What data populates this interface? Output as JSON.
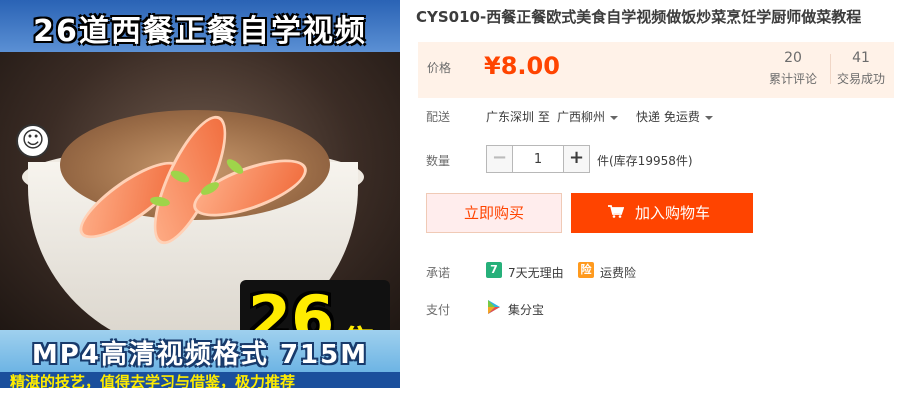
{
  "product_image": {
    "top_banner": "26道西餐正餐自学视频",
    "episode_number": "26",
    "episode_unit": "集",
    "bottom_banner": "MP4高清视频格式  715M",
    "footer_strip": "精湛的技艺，值得去学习与借鉴，极力推荐"
  },
  "title": "CYS010-西餐正餐欧式美食自学视频做饭炒菜烹饪学厨师做菜教程",
  "price": {
    "label": "价格",
    "value": "¥8.00",
    "color": "#ff4400"
  },
  "stats": [
    {
      "number": "20",
      "label": "累计评论"
    },
    {
      "number": "41",
      "label": "交易成功"
    }
  ],
  "shipping": {
    "label": "配送",
    "from": "广东深圳 至",
    "to": "广西柳州",
    "method": "快递 免运费"
  },
  "quantity": {
    "label": "数量",
    "minus": "−",
    "value": "1",
    "plus": "+",
    "stock": "件(库存19958件)"
  },
  "buttons": {
    "buy_now": "立即购买",
    "add_to_cart": "加入购物车"
  },
  "promise": {
    "label": "承诺",
    "items": [
      {
        "icon": "seven-day-return-icon",
        "badge": "7",
        "text": "7天无理由"
      },
      {
        "icon": "shipping-insurance-icon",
        "badge": "险",
        "text": "运费险"
      }
    ]
  },
  "payment": {
    "label": "支付",
    "method": "集分宝",
    "icon": "jifenbao-icon"
  }
}
